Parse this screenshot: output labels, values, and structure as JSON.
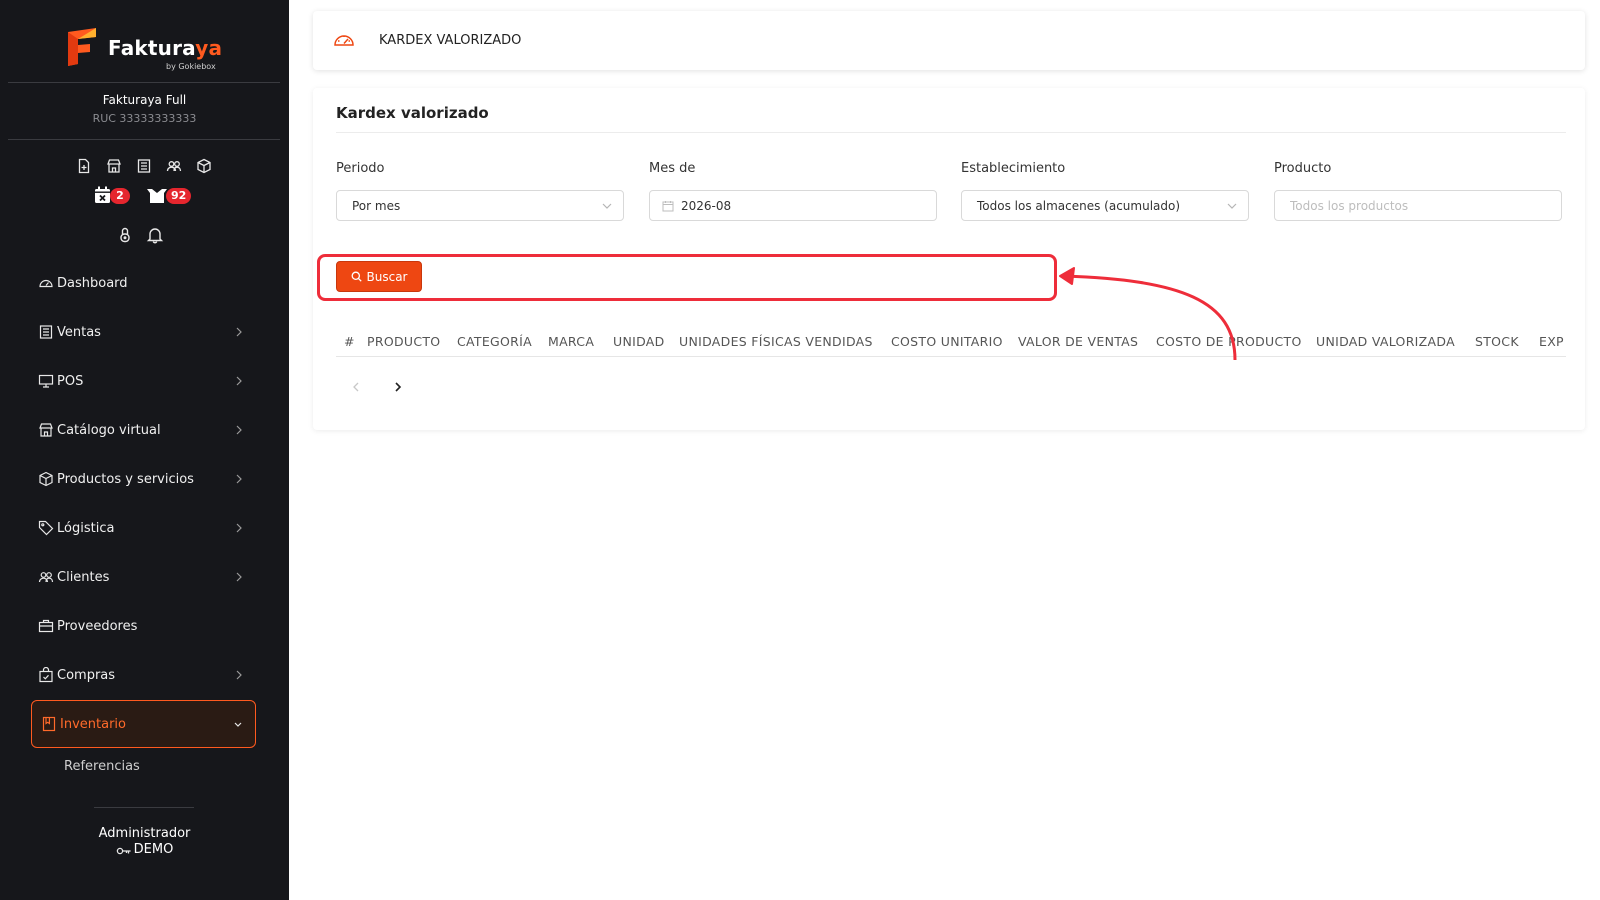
{
  "app": {
    "brand": "Fakturaya",
    "brand_sub": "by Gokiebox",
    "company_name": "Fakturaya Full",
    "company_ruc": "RUC 33333333333"
  },
  "badges": {
    "calendar_count": "2",
    "box_count": "92"
  },
  "sidebar": {
    "items": [
      {
        "label": "Dashboard",
        "icon": "gauge-icon"
      },
      {
        "label": "Ventas",
        "icon": "receipt-icon"
      },
      {
        "label": "POS",
        "icon": "monitor-icon"
      },
      {
        "label": "Catálogo virtual",
        "icon": "store-icon"
      },
      {
        "label": "Productos y servicios",
        "icon": "box-icon"
      },
      {
        "label": "Lógistica",
        "icon": "tag-icon"
      },
      {
        "label": "Clientes",
        "icon": "users-icon"
      },
      {
        "label": "Proveedores",
        "icon": "briefcase-icon"
      },
      {
        "label": "Compras",
        "icon": "bag-icon"
      },
      {
        "label": "Inventario",
        "icon": "book-icon"
      }
    ],
    "sub_items": [
      {
        "label": "Referencias"
      }
    ]
  },
  "user": {
    "role": "Administrador",
    "name": "DEMO"
  },
  "header": {
    "title": "KARDEX VALORIZADO"
  },
  "card": {
    "title": "Kardex valorizado"
  },
  "filters": {
    "periodo": {
      "label": "Periodo",
      "value": "Por mes"
    },
    "mes": {
      "label": "Mes de",
      "value": "2026-08"
    },
    "establecimiento": {
      "label": "Establecimiento",
      "value": "Todos los almacenes (acumulado)"
    },
    "producto": {
      "label": "Producto",
      "placeholder": "Todos los productos"
    }
  },
  "buttons": {
    "buscar": "Buscar"
  },
  "table": {
    "columns": [
      "#",
      "PRODUCTO",
      "CATEGORÍA",
      "MARCA",
      "UNIDAD",
      "UNIDADES FÍSICAS VENDIDAS",
      "COSTO UNITARIO",
      "VALOR DE VENTAS",
      "COSTO DE PRODUCTO",
      "UNIDAD VALORIZADA",
      "STOCK",
      "EXP"
    ]
  },
  "colors": {
    "accent": "#ee4712",
    "sidebar_bg": "#16171b",
    "highlight": "#ee2d3a",
    "badge": "#e5262e"
  }
}
